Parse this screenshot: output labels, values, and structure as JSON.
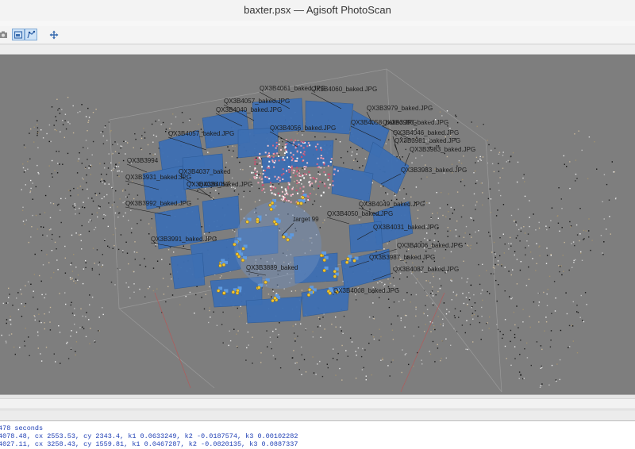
{
  "window": {
    "title": "baxter.psx — Agisoft PhotoScan"
  },
  "toolbar": {
    "buttons": [
      {
        "icon": "camera-icon",
        "active": false
      },
      {
        "icon": "select-region-icon",
        "active": true
      },
      {
        "icon": "select-points-icon",
        "active": true
      },
      {
        "icon": "move-icon",
        "active": false
      }
    ]
  },
  "viewport": {
    "background": "#7e7e7e",
    "mesh_color": "#3d6fb3",
    "camera_labels": [
      "QX3B4061_baked.JPG",
      "QX3B4060_baked.JPG",
      "QX3B4057_baked.JPG",
      "QX3B4040_baked.JPG",
      "QX3B4056_baked.JPG",
      "QX3B4057_baked.JPG",
      "QX3B4058_baked.JPG",
      "QX3B3980_baked.JPG",
      "QX3B4046_baked.JPG",
      "QX3B3981_baked.JPG",
      "QX3B3979_baked.JPG",
      "QX3B3983_baked.JPG",
      "QX3B3983_baked.JPG",
      "QX3B3994",
      "QX3B4037_baked",
      "QX3B3931_baked.JPG",
      "QX3B4036_baked.JPG",
      "QX3B4052",
      "QX3B3992_baked.JPG",
      "QX3B4050_baked.JPG",
      "QX3B4049_baked.JPG",
      "QX3B4031_baked.JPG",
      "QX3B3991_baked.JPG",
      "QX3B4006_baked.JPG",
      "QX3B3987_baked.JPG",
      "QX3B3889_baked",
      "QX3B4087_baked.JPG",
      "QX3B4008_baked.JPG",
      "target 99"
    ]
  },
  "console": {
    "lines": [
      "478 seconds",
      "4078.48, cx 2553.53, cy 2343.4, k1 0.0633249, k2 -0.0187574, k3 0.00102282",
      "4027.11, cx 3258.43, cy 1559.81, k1 0.0467287, k2 -0.0820135, k3 0.0887337"
    ]
  }
}
